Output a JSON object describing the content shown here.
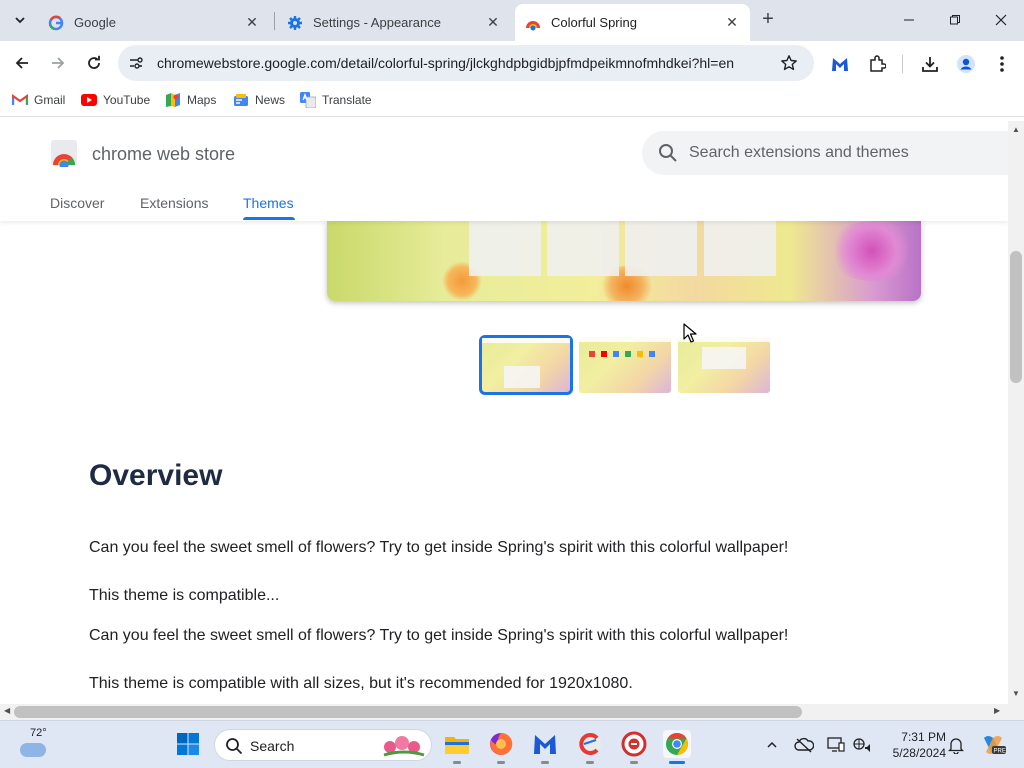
{
  "browser": {
    "tabs": [
      {
        "title": "Google",
        "favicon": "google-icon",
        "active": false
      },
      {
        "title": "Settings - Appearance",
        "favicon": "gear-icon",
        "active": false
      },
      {
        "title": "Colorful Spring",
        "favicon": "chrome-web-store-icon",
        "active": true
      }
    ],
    "url": "chromewebstore.google.com/detail/colorful-spring/jlckghdpbgidbjpfmdpeikmnofmhdkei?hl=en",
    "bookmarks": [
      {
        "label": "Gmail",
        "icon": "gmail-icon"
      },
      {
        "label": "YouTube",
        "icon": "youtube-icon"
      },
      {
        "label": "Maps",
        "icon": "maps-icon"
      },
      {
        "label": "News",
        "icon": "news-icon"
      },
      {
        "label": "Translate",
        "icon": "translate-icon"
      }
    ]
  },
  "store": {
    "name": "chrome web store",
    "search_placeholder": "Search extensions and themes",
    "nav": [
      {
        "label": "Discover",
        "active": false
      },
      {
        "label": "Extensions",
        "active": false
      },
      {
        "label": "Themes",
        "active": true
      }
    ]
  },
  "content": {
    "overview_heading": "Overview",
    "paragraphs": [
      "Can you feel the sweet smell of flowers? Try to get inside Spring's spirit with this colorful wallpaper!",
      "This theme is compatible...",
      "Can you feel the sweet smell of flowers? Try to get inside Spring's spirit with this colorful wallpaper!",
      "This theme is compatible with all sizes, but it's recommended for 1920x1080."
    ],
    "selected_thumbnail": 1,
    "thumbnail_count": 3
  },
  "taskbar": {
    "weather_temp": "72°",
    "search_label": "Search",
    "apps": [
      "start-icon",
      "file-explorer-icon",
      "firefox-icon",
      "malwarebytes-icon",
      "ccleaner-icon",
      "app-icon",
      "chrome-icon"
    ],
    "time": "7:31 PM",
    "date": "5/28/2024"
  },
  "colors": {
    "accent": "#1a73e8",
    "heading": "#1f2a44",
    "tabstrip": "#dfe3eb"
  }
}
